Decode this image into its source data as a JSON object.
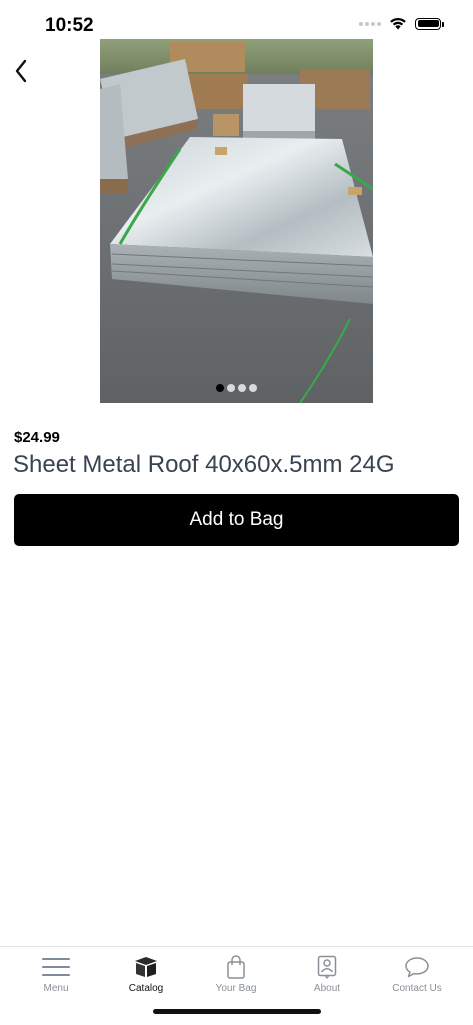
{
  "status_bar": {
    "time": "10:52"
  },
  "product": {
    "price": "$24.99",
    "title": "Sheet Metal Roof 40x60x.5mm 24G",
    "image_count": 4,
    "active_image": 1
  },
  "actions": {
    "add_to_bag_label": "Add to Bag"
  },
  "tab_bar": {
    "items": [
      {
        "label": "Menu",
        "icon": "menu-icon",
        "active": false
      },
      {
        "label": "Catalog",
        "icon": "catalog-box-icon",
        "active": true
      },
      {
        "label": "Your Bag",
        "icon": "shopping-bag-icon",
        "active": false
      },
      {
        "label": "About",
        "icon": "contact-card-icon",
        "active": false
      },
      {
        "label": "Contact Us",
        "icon": "speech-bubble-icon",
        "active": false
      }
    ]
  },
  "colors": {
    "button_bg": "#000000",
    "title_text": "#3a4352",
    "tab_inactive": "#8a9097",
    "tab_active": "#111111"
  }
}
